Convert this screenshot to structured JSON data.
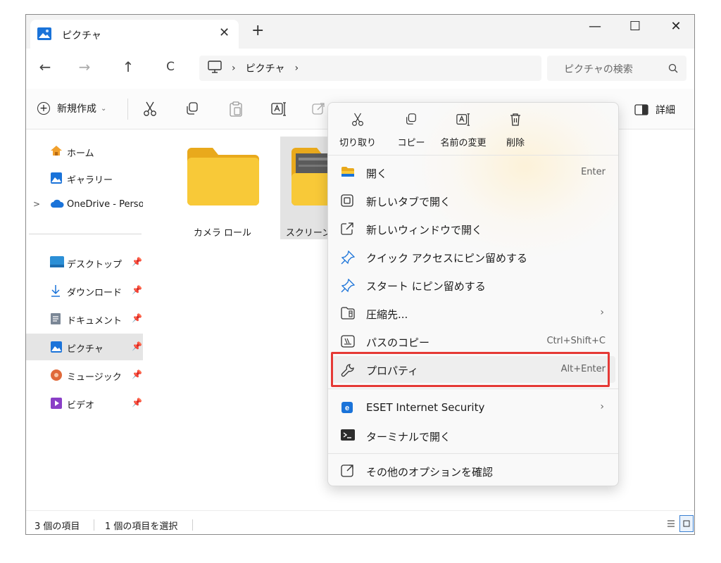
{
  "window": {
    "tab_title": "ピクチャ",
    "tab_close": "✕",
    "new_tab": "+",
    "controls": {
      "minimize": "—",
      "maximize": "☐",
      "close": "✕"
    }
  },
  "navigation": {
    "back": "←",
    "forward": "→",
    "up": "↑",
    "refresh": "C"
  },
  "address": {
    "separator": "›",
    "crumb": "ピクチャ",
    "trailing_separator": "›"
  },
  "search": {
    "placeholder": "ピクチャの検索"
  },
  "command_bar": {
    "new_label": "新規作成",
    "new_chevron": "⌄",
    "details_label": "詳細"
  },
  "nav_pane": {
    "home": "ホーム",
    "gallery": "ギャラリー",
    "onedrive": "OneDrive - Perso",
    "onedrive_expand": ">",
    "desktop": "デスクトップ",
    "downloads": "ダウンロード",
    "documents": "ドキュメント",
    "pictures": "ピクチャ",
    "music": "ミュージック",
    "videos": "ビデオ",
    "pin": "📌"
  },
  "files": [
    {
      "name": "カメラ ロール"
    },
    {
      "name": "スクリーンショット"
    }
  ],
  "status": {
    "item_count": "3 個の項目",
    "selection": "1 個の項目を選択"
  },
  "context_menu": {
    "quick_actions": {
      "cut": "切り取り",
      "copy": "コピー",
      "rename": "名前の変更",
      "delete": "削除"
    },
    "items": {
      "open": {
        "label": "開く",
        "accel": "Enter"
      },
      "open_new_tab": {
        "label": "新しいタブで開く"
      },
      "open_new_window": {
        "label": "新しいウィンドウで開く"
      },
      "pin_quick_access": {
        "label": "クイック アクセスにピン留めする"
      },
      "pin_start": {
        "label": "スタート にピン留めする"
      },
      "compress": {
        "label": "圧縮先...",
        "arrow": "›"
      },
      "copy_path": {
        "label": "パスのコピー",
        "accel": "Ctrl+Shift+C"
      },
      "properties": {
        "label": "プロパティ",
        "accel": "Alt+Enter"
      },
      "eset": {
        "label": "ESET Internet Security",
        "arrow": "›"
      },
      "terminal": {
        "label": "ターミナルで開く"
      },
      "more_options": {
        "label": "その他のオプションを確認"
      }
    }
  },
  "colors": {
    "highlight": "#e53935",
    "folder_yellow": "#f8c938",
    "accent_blue": "#1a73d9"
  }
}
